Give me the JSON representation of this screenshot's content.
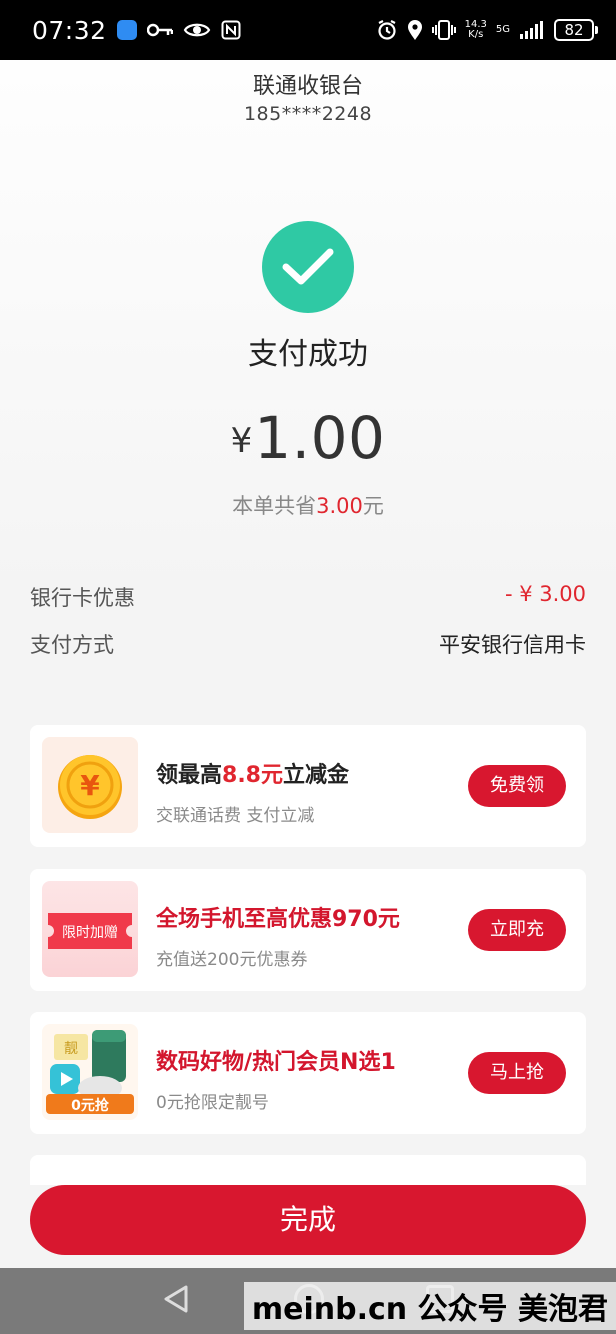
{
  "status_bar": {
    "time": "07:32",
    "speed_top": "14.3",
    "speed_bottom": "K/s",
    "network": "5G",
    "battery": "82"
  },
  "header": {
    "title": "联通收银台",
    "phone": "185****2248"
  },
  "result": {
    "status_text": "支付成功",
    "currency": "¥",
    "amount": "1.00",
    "save_prefix": "本单共省",
    "save_amount": "3.00",
    "save_suffix": "元"
  },
  "details": [
    {
      "label": "银行卡优惠",
      "value": "- ¥ 3.00"
    },
    {
      "label": "支付方式",
      "value": "平安银行信用卡"
    }
  ],
  "offers": [
    {
      "title_pre": "领最高",
      "title_hl": "8.8元",
      "title_post": "立减金",
      "subtitle": "交联通话费 支付立减",
      "button": "免费领",
      "thumb_text": "¥"
    },
    {
      "title": "全场手机至高优惠970元",
      "subtitle": "充值送200元优惠券",
      "button": "立即充",
      "thumb_text": "限时加赠"
    },
    {
      "title": "数码好物/热门会员N选1",
      "subtitle": "0元抢限定靓号",
      "button": "马上抢",
      "thumb_badge": "0元抢",
      "thumb_tag": "靓"
    }
  ],
  "done_button": "完成",
  "watermark": "meinb.cn  公众号 美泡君",
  "colors": {
    "accent_red": "#d8172f",
    "success_green": "#2fc9a4"
  }
}
